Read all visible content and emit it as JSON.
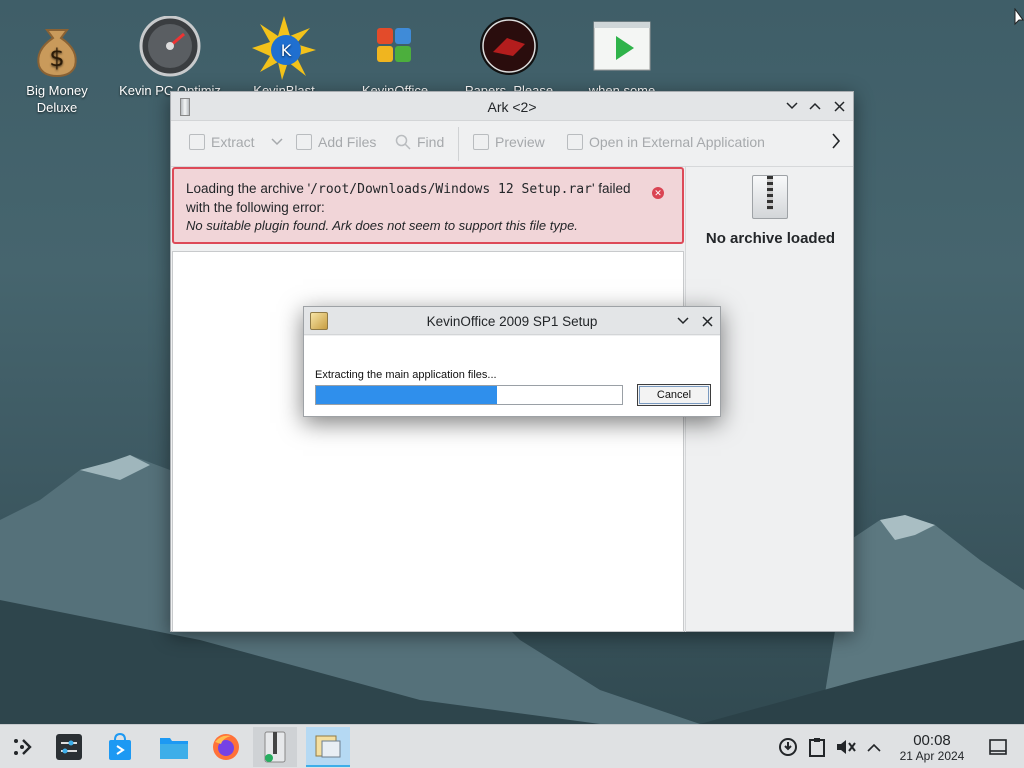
{
  "desktop": {
    "icons": [
      {
        "label": "Big Money Deluxe"
      },
      {
        "label": "Kevin PC Optimiz"
      },
      {
        "label": "KevinBlast"
      },
      {
        "label": "KevinOffice"
      },
      {
        "label": "Papers, Please"
      },
      {
        "label": "when some"
      }
    ]
  },
  "ark": {
    "title": "Ark <2>",
    "toolbar": {
      "extract": "Extract",
      "add_files": "Add Files",
      "find": "Find",
      "preview": "Preview",
      "open_external": "Open in External Application"
    },
    "error": {
      "line1_prefix": "Loading the archive '",
      "path": "/root/Downloads/Windows 12 Setup.rar",
      "line1_suffix": "' failed",
      "line2": "with the following error:",
      "line3": "No suitable plugin found. Ark does not seem to support this file type."
    },
    "side_panel": {
      "status": "No archive loaded"
    }
  },
  "setup_dialog": {
    "title": "KevinOffice 2009 SP1 Setup",
    "message": "Extracting the main application files...",
    "progress_fraction": 0.59,
    "cancel_label": "Cancel"
  },
  "taskbar": {
    "clock": {
      "time": "00:08",
      "date": "21 Apr 2024"
    }
  },
  "colors": {
    "accent": "#3daee9",
    "progress": "#2f8fec",
    "error_border": "#dd4a58",
    "error_bg": "#f1d5d8"
  }
}
